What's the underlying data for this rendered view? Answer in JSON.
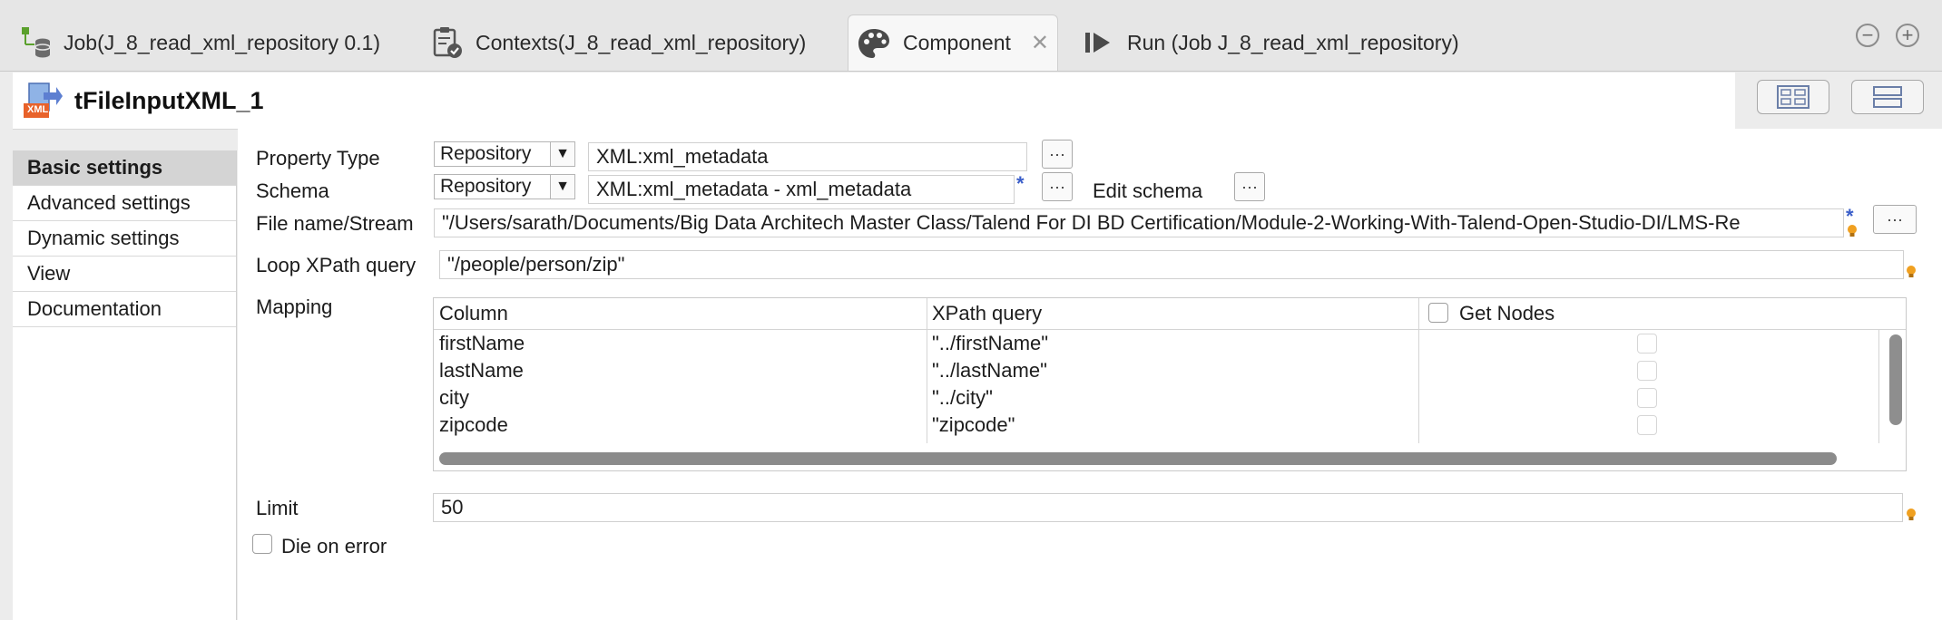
{
  "tabs": [
    {
      "label": "Job(J_8_read_xml_repository 0.1)",
      "icon": "job-database-icon"
    },
    {
      "label": "Contexts(J_8_read_xml_repository)",
      "icon": "contexts-clipboard-icon"
    },
    {
      "label": "Component",
      "icon": "palette-icon",
      "active": true,
      "close": "✕"
    },
    {
      "label": "Run (Job J_8_read_xml_repository)",
      "icon": "run-icon"
    }
  ],
  "window_controls": {
    "minimize": "−",
    "maximize": "+"
  },
  "component": {
    "title": "tFileInputXML_1",
    "icon_text": "XML"
  },
  "nav": [
    {
      "label": "Basic settings",
      "selected": true
    },
    {
      "label": "Advanced settings"
    },
    {
      "label": "Dynamic settings"
    },
    {
      "label": "View"
    },
    {
      "label": "Documentation"
    }
  ],
  "form": {
    "property_type": {
      "label": "Property Type",
      "type_value": "Repository",
      "value": "XML:xml_metadata",
      "button": "···"
    },
    "schema": {
      "label": "Schema",
      "type_value": "Repository",
      "value": "XML:xml_metadata - xml_metadata",
      "modified_mark": "*",
      "button": "···",
      "edit_label": "Edit schema",
      "edit_button": "···"
    },
    "file_name": {
      "label": "File name/Stream",
      "value": "\"/Users/sarath/Documents/Big Data Architech Master Class/Talend For DI BD Certification/Module-2-Working-With-Talend-Open-Studio-DI/LMS-Re",
      "modified_mark": "*",
      "button": "···"
    },
    "loop_xpath": {
      "label": "Loop XPath query",
      "value": "\"/people/person/zip\""
    },
    "mapping": {
      "label": "Mapping",
      "headers": {
        "column": "Column",
        "xpath": "XPath query",
        "get_nodes": "Get Nodes"
      },
      "rows": [
        {
          "column": "firstName",
          "xpath": "\"../firstName\"",
          "get_nodes": false
        },
        {
          "column": "lastName",
          "xpath": "\"../lastName\"",
          "get_nodes": false
        },
        {
          "column": "city",
          "xpath": "\"../city\"",
          "get_nodes": false
        },
        {
          "column": "zipcode",
          "xpath": "\"zipcode\"",
          "get_nodes": false
        }
      ]
    },
    "limit": {
      "label": "Limit",
      "value": "50"
    },
    "die_on_error": {
      "label": "Die on error",
      "checked": false
    }
  },
  "colors": {
    "star": "#3a5ec9",
    "bulb": "#f0a020",
    "nav_selected": "#d4d4d4"
  }
}
